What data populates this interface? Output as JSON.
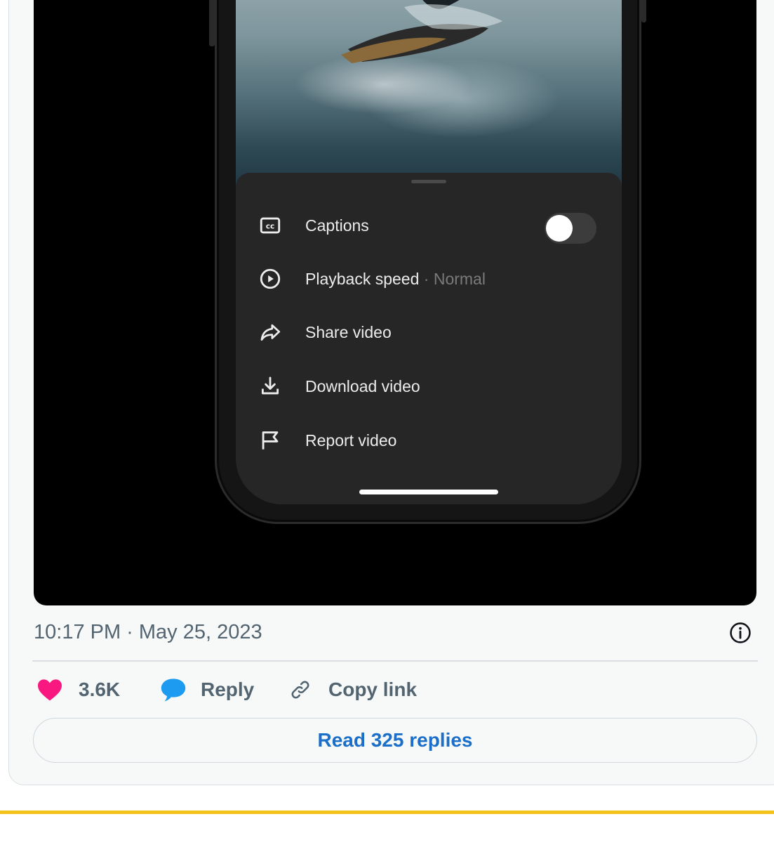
{
  "video_menu": {
    "items": [
      {
        "label": "Captions",
        "icon": "captions-icon",
        "toggle_on": false
      },
      {
        "label": "Playback speed",
        "sub": "· Normal",
        "icon": "play-circle-icon"
      },
      {
        "label": "Share video",
        "icon": "share-icon"
      },
      {
        "label": "Download video",
        "icon": "download-icon"
      },
      {
        "label": "Report video",
        "icon": "flag-icon"
      }
    ]
  },
  "tweet": {
    "timestamp": "10:17 PM · May 25, 2023",
    "likes": "3.6K",
    "reply_label": "Reply",
    "copy_link_label": "Copy link",
    "read_replies_label": "Read 325 replies"
  },
  "colors": {
    "like_pink": "#f91880",
    "reply_blue": "#1d9bf0",
    "link_blue": "#1b6fc9",
    "accent_yellow": "#f3c31b"
  }
}
